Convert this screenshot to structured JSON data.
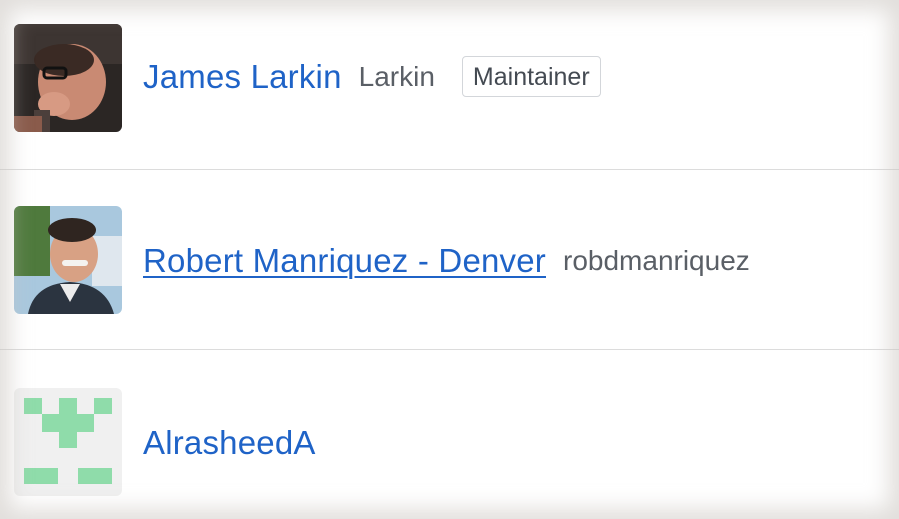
{
  "members": [
    {
      "display_name": "James Larkin",
      "username": "Larkin",
      "role": "Maintainer",
      "avatar": "photo-avatar"
    },
    {
      "display_name": "Robert Manriquez - Denver",
      "username": "robdmanriquez",
      "avatar": "photo-avatar"
    },
    {
      "display_name": "AlrasheedA",
      "username": "",
      "avatar": "identicon-avatar",
      "identicon_color": "#8fdcaa"
    }
  ],
  "colors": {
    "link": "#1f63c7",
    "username": "#5a5f66",
    "divider": "#dcdcdc"
  }
}
